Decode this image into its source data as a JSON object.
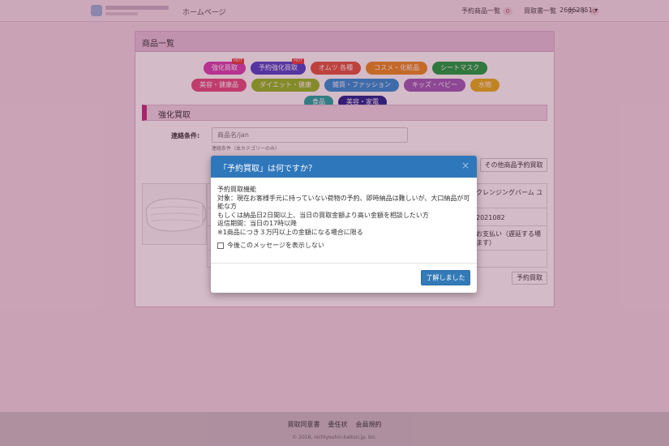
{
  "navbar": {
    "home": "ホームページ",
    "links": [
      {
        "label": "予約商品一覧",
        "badge": "0"
      },
      {
        "label": "買取書一覧",
        "badge": ""
      },
      {
        "label": "カート",
        "badge": "0"
      }
    ],
    "user": "26662851 ▾"
  },
  "panel": {
    "title": "商品一覧",
    "tags": [
      {
        "label": "強化買取",
        "color": "#d63db0",
        "hot": "HOT"
      },
      {
        "label": "予約強化買取",
        "color": "#4a3fc9",
        "hot": "HOT"
      },
      {
        "label": "オムツ 各種",
        "color": "#e0523a",
        "hot": ""
      },
      {
        "label": "コスメ・化粧品",
        "color": "#e98b1c",
        "hot": ""
      },
      {
        "label": "シートマスク",
        "color": "#17a03c",
        "hot": ""
      },
      {
        "label": "美容・健康品",
        "color": "#e24a7f",
        "hot": ""
      },
      {
        "label": "ダイエット・健康",
        "color": "#8fba1d",
        "hot": ""
      },
      {
        "label": "雑貨・ファッション",
        "color": "#2a8fd6",
        "hot": ""
      },
      {
        "label": "キッズ・ベビー",
        "color": "#9b59b6",
        "hot": ""
      },
      {
        "label": "水物",
        "color": "#e4b114",
        "hot": ""
      },
      {
        "label": "食品",
        "color": "#1aa8a0",
        "hot": ""
      },
      {
        "label": "美容・家電",
        "color": "#1d1f8c",
        "hot": ""
      }
    ],
    "section_title": "強化買取",
    "filter": {
      "label": "連絡条件:",
      "placeholder": "商品名/jan",
      "hint": "連絡条件（本カテゴリーのみ）"
    },
    "other_button": "その他商品予約買取",
    "product": {
      "name": "クレンジングバーム ユ",
      "code": "2021082",
      "payment": "ます）",
      "payment_line1": "お支払い（遅延する場"
    },
    "reserve_button": "予約買取"
  },
  "footer": {
    "links": [
      "買取同意書",
      "委任状",
      "会員規約"
    ],
    "copyright": "© 2016, nichiyouhin-kaitori.jp, Inc."
  },
  "modal": {
    "title": "「予約買取」は何ですか？",
    "close": "×",
    "lines": [
      "予約買取機能",
      "対象：現在お客様手元に持っていない荷物の予約、即時納品は難しいが、大口納品が可能な方",
      "もしくは納品日2日間以上、当日の買取金額より高い金額を相談したい方",
      "返信期間：当日の17時以降",
      "※1商品につき３万円以上の金額になる場合に限る"
    ],
    "checkbox_label": "今後このメッセージを表示しない",
    "ok_button": "了解しました"
  }
}
